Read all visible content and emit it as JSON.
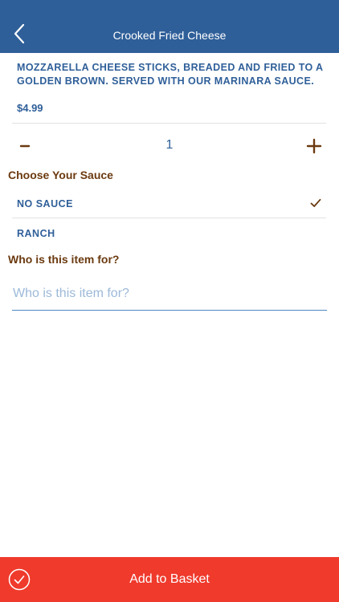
{
  "header": {
    "title": "Crooked Fried Cheese",
    "back_icon": "chevron-left-icon"
  },
  "item": {
    "description": "Mozzarella cheese sticks, breaded and fried to a golden brown. Served with our marinara sauce.",
    "price": "$4.99"
  },
  "stepper": {
    "minus_icon": "minus-icon",
    "quantity": "1",
    "plus_icon": "plus-icon"
  },
  "sauce": {
    "title": "Choose Your Sauce",
    "options": [
      {
        "label": "No Sauce",
        "selected": true
      },
      {
        "label": "Ranch",
        "selected": false
      }
    ]
  },
  "who": {
    "title": "Who is this item for?",
    "placeholder": "Who is this item for?",
    "value": ""
  },
  "footer": {
    "label": "Add to Basket",
    "icon": "check-circle-icon"
  },
  "colors": {
    "header_bg": "#2f5f99",
    "primary_text": "#2f5f99",
    "section_title": "#6b3a10",
    "footer_bg": "#ef3a2c",
    "input_underline": "#4f86c6"
  }
}
